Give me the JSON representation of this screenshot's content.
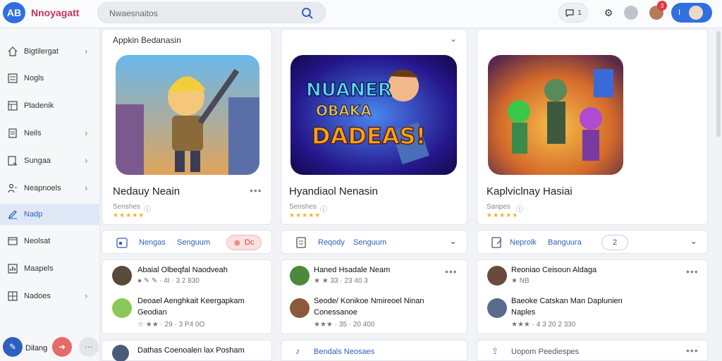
{
  "app": {
    "logo": "AB",
    "name": "Nnoyagatt"
  },
  "search": {
    "placeholder": "Nwaesnaitos"
  },
  "topbar": {
    "notif_count_label": "1",
    "badge_count": "3",
    "profile_label": "I"
  },
  "sidebar": {
    "items": [
      {
        "label": "Bigtilergat",
        "icon": "home-icon",
        "chevron": true
      },
      {
        "label": "Nogls",
        "icon": "list-icon",
        "chevron": false
      },
      {
        "label": "Pladenik",
        "icon": "table-icon",
        "chevron": false
      },
      {
        "label": "Neils",
        "icon": "document-icon",
        "chevron": true
      },
      {
        "label": "Sungaa",
        "icon": "edit-icon",
        "chevron": true
      },
      {
        "label": "Neapnoels",
        "icon": "people-icon",
        "chevron": true
      },
      {
        "label": "Nadp",
        "icon": "pencil-icon",
        "chevron": false,
        "active": true
      },
      {
        "label": "Neolsat",
        "icon": "window-icon",
        "chevron": false
      },
      {
        "label": "Maapels",
        "icon": "chart-icon",
        "chevron": false
      },
      {
        "label": "Nadoes",
        "icon": "grid-icon",
        "chevron": true
      }
    ],
    "footer": {
      "label": "Dilang"
    }
  },
  "section": {
    "title": "Appkin Bedanasin"
  },
  "games": [
    {
      "title": "Nedauy Neain",
      "subtitle": "Senshes",
      "stars": "★★★★★"
    },
    {
      "title": "Hyandiaol Nenasin",
      "subtitle": "Senshes",
      "stars": "★★★★★",
      "art_text": [
        "NUANER",
        "OBAKA",
        "DADEAS!"
      ]
    },
    {
      "title": "Kaplviclnay Hasiai",
      "subtitle": "Sanpes",
      "stars": "★★★★★"
    }
  ],
  "tabs": [
    {
      "label1": "Nengas",
      "label2": "Senguum",
      "pill": "Dc"
    },
    {
      "label1": "Reqody",
      "label2": "Senguum"
    },
    {
      "label1": "Neprolk",
      "label2": "Banguura",
      "pill": "2"
    }
  ],
  "lists": [
    [
      {
        "name": "Abaial Olbeqfal Naodveah",
        "meta": "● ✎ ✎ · 4I · 3 2 830"
      },
      {
        "name": "Deoael Aenghkait Keergapkam",
        "name2": "Geodian",
        "meta": "☆ ★★ · 29 · 3 P4 0O"
      }
    ],
    [
      {
        "name": "Haned Hsadale Neam",
        "meta": "★ ★ 33 · 23 40 3"
      },
      {
        "name": "Seode/ Konikoe Nmireoel Ninan",
        "name2": "Conessanoe",
        "meta": "★★★ · 35 · 20 400"
      }
    ],
    [
      {
        "name": "Reoniao Ceisoun Aldaga",
        "meta": "★ NB"
      },
      {
        "name": "Baeoke Catskan Man Daplunien",
        "name2": "Naples",
        "meta": "★★★ · 4 3 20 2 330"
      }
    ]
  ],
  "bottom": [
    {
      "label": "Dathas Coenoalen lax Posham"
    },
    {
      "label": "Bendals Neosaes"
    },
    {
      "label": "Uopom Peediespes"
    }
  ]
}
